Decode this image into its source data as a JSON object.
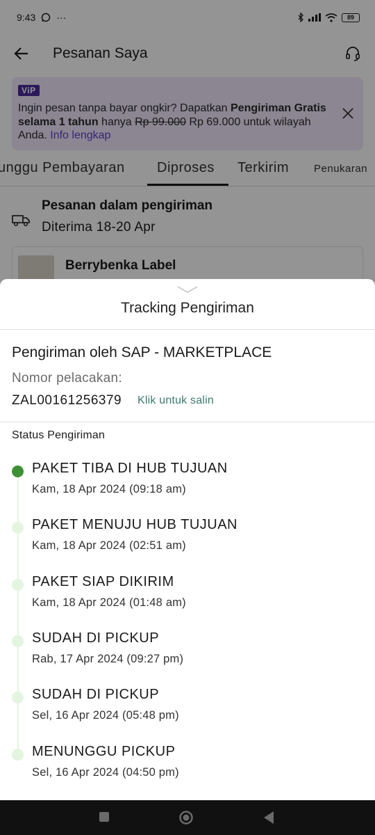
{
  "status_bar": {
    "time": "9:43",
    "dots": "···",
    "battery": "89"
  },
  "header": {
    "title": "Pesanan Saya"
  },
  "vip_banner": {
    "badge": "ViP",
    "text_intro": "Ingin pesan tanpa bayar ongkir? Dapatkan ",
    "text_bold": "Pengiriman Gratis selama 1 tahun",
    "text_mid": " hanya ",
    "old_price": "Rp 99.000",
    "new_price": " Rp 69.000 untuk wilayah Anda. ",
    "link": "Info lengkap"
  },
  "tabs": [
    {
      "label": "unggu Pembayaran"
    },
    {
      "label": "Diproses"
    },
    {
      "label": "Terkirim"
    },
    {
      "label": "Penukaran"
    }
  ],
  "shipment": {
    "title": "Pesanan dalam pengiriman",
    "eta": "Diterima 18-20 Apr"
  },
  "order": {
    "brand": "Berrybenka Label"
  },
  "sheet": {
    "title": "Tracking Pengiriman",
    "carrier": "Pengiriman oleh SAP - MARKETPLACE",
    "tracking_label": "Nomor pelacakan:",
    "tracking_number": "ZAL00161256379",
    "copy_link": "Klik untuk salin",
    "status_heading": "Status Pengiriman",
    "steps": [
      {
        "title": "PAKET TIBA DI HUB TUJUAN",
        "date": "Kam, 18 Apr 2024 (09:18 am)"
      },
      {
        "title": "PAKET MENUJU HUB TUJUAN",
        "date": "Kam, 18 Apr 2024 (02:51 am)"
      },
      {
        "title": "PAKET SIAP DIKIRIM",
        "date": "Kam, 18 Apr 2024 (01:48 am)"
      },
      {
        "title": "SUDAH DI PICKUP",
        "date": "Rab, 17 Apr 2024 (09:27 pm)"
      },
      {
        "title": "SUDAH DI PICKUP",
        "date": "Sel, 16 Apr 2024 (05:48 pm)"
      },
      {
        "title": "MENUNGGU PICKUP",
        "date": "Sel, 16 Apr 2024 (04:50 pm)"
      }
    ]
  },
  "colors": {
    "accent_green": "#3f8f35",
    "timeline_light": "#e3f5df",
    "link_teal": "#3e7a6d",
    "vip_purple": "#4a2a9a"
  }
}
